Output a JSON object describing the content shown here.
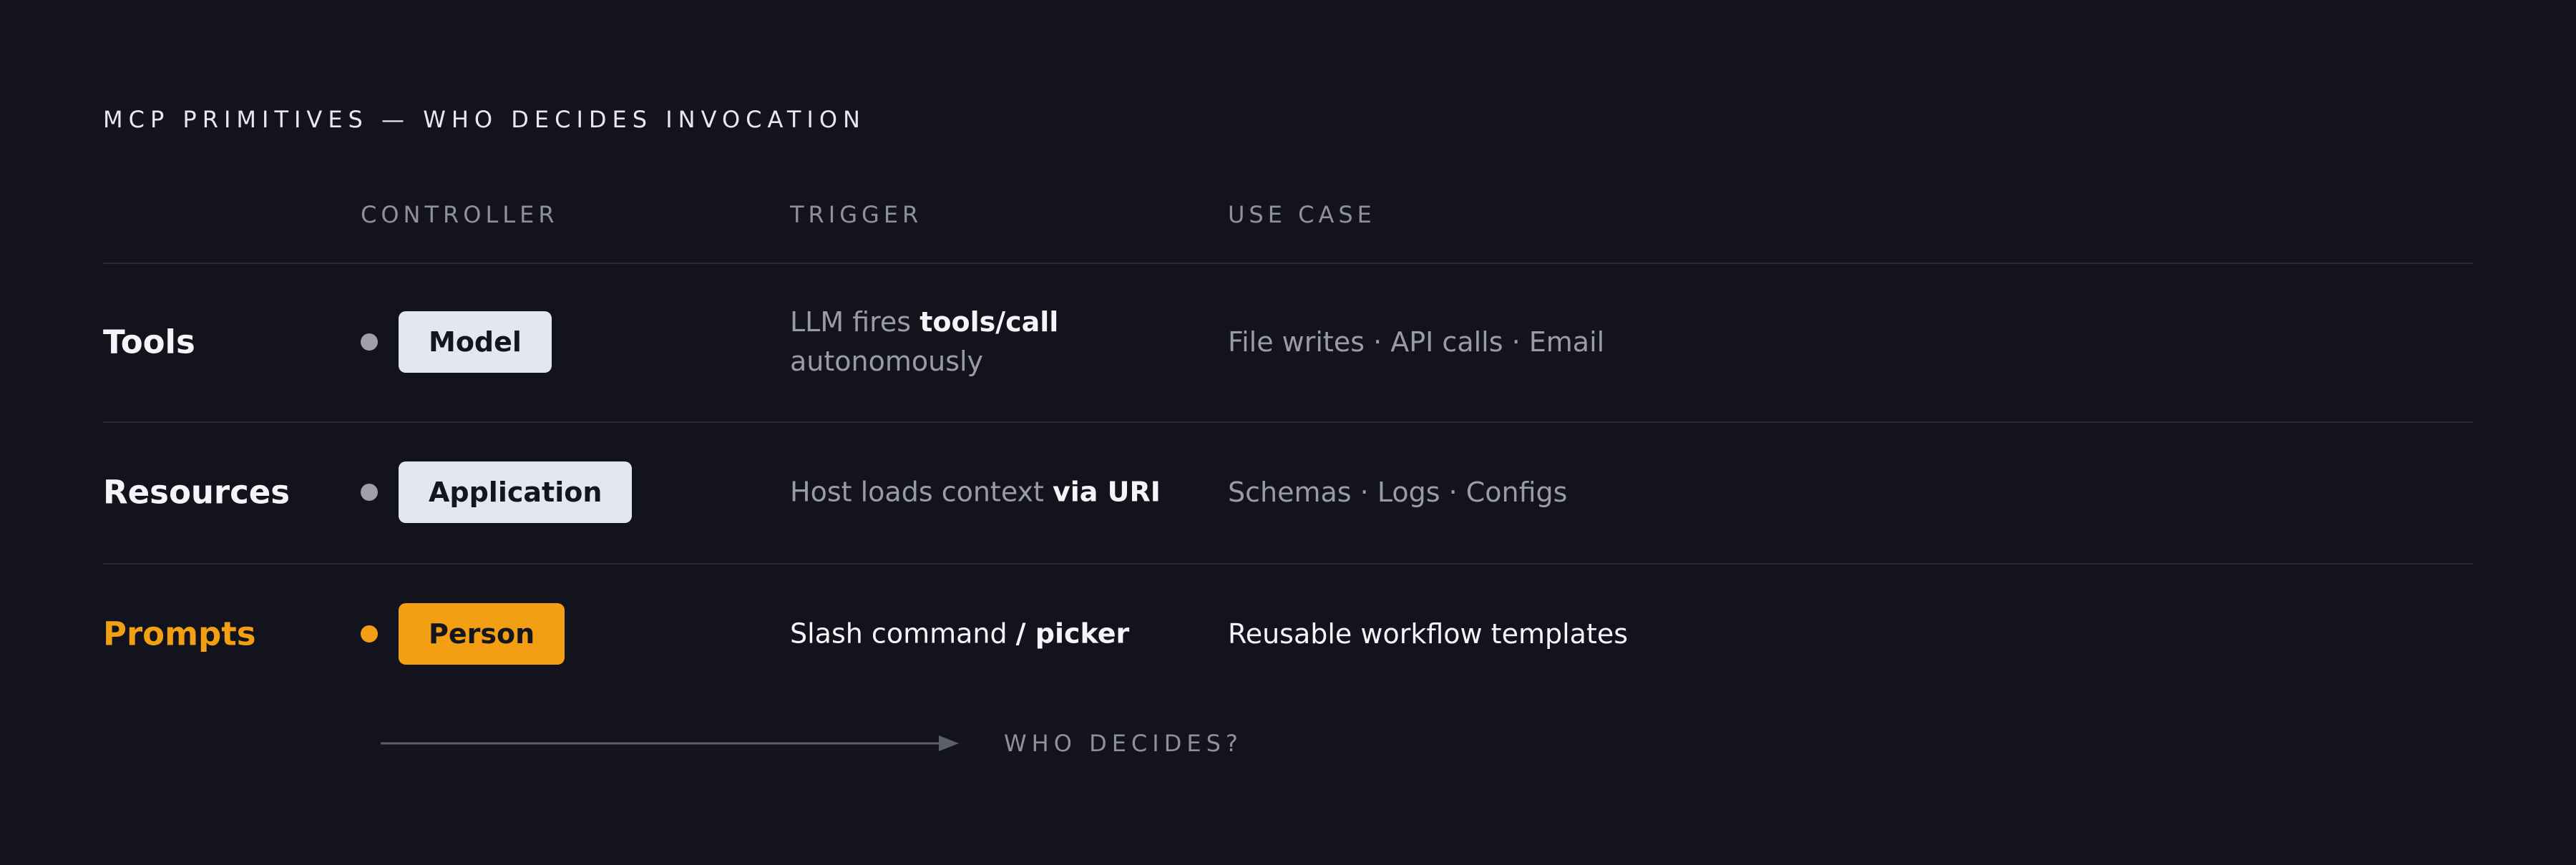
{
  "kicker": "MCP PRIMITIVES — WHO DECIDES INVOCATION",
  "columns": {
    "controller": "CONTROLLER",
    "trigger": "TRIGGER",
    "use_case": "USE CASE"
  },
  "rows": [
    {
      "name": "Tools",
      "controller": "Model",
      "trigger_lead": "LLM fires ",
      "trigger_strong": "tools/call",
      "trigger_tail": "autonomously",
      "use_case": "File writes · API calls · Email"
    },
    {
      "name": "Resources",
      "controller": "Application",
      "trigger_lead": "Host loads context ",
      "trigger_strong": "via URI",
      "use_case": "Schemas · Logs · Configs"
    },
    {
      "name": "Prompts",
      "controller": "Person",
      "trigger_lead": "Slash command ",
      "trigger_strong": "/ picker",
      "use_case": "Reusable workflow templates"
    }
  ],
  "axis_label": "WHO DECIDES?",
  "colors": {
    "background": "#12131d",
    "accent": "#f29f14",
    "pill": "#e3e7f1",
    "muted_text": "#9a9ba8",
    "rule": "#272937"
  }
}
